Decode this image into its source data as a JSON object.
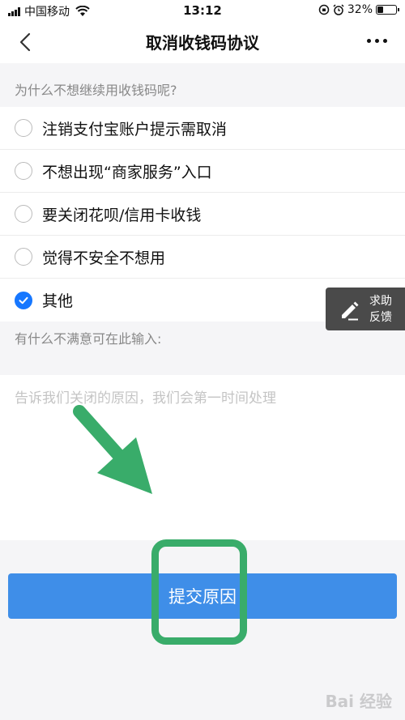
{
  "status_bar": {
    "carrier": "中国移动",
    "time": "13:12",
    "battery": "32%",
    "battery_level": 0.32
  },
  "nav": {
    "title": "取消收钱码协议"
  },
  "question": "为什么不想继续用收钱码呢?",
  "options": [
    {
      "label": "注销支付宝账户提示需取消",
      "checked": false
    },
    {
      "label": "不想出现“商家服务”入口",
      "checked": false
    },
    {
      "label": "要关闭花呗/信用卡收钱",
      "checked": false
    },
    {
      "label": "觉得不安全不想用",
      "checked": false
    },
    {
      "label": "其他",
      "checked": true
    }
  ],
  "feedback": {
    "line1": "求助",
    "line2": "反馈"
  },
  "input_section": {
    "label": "有什么不满意可在此输入:",
    "placeholder": "告诉我们关闭的原因，我们会第一时间处理",
    "value": ""
  },
  "submit_label": "提交原因",
  "watermark": "Bai 经验",
  "colors": {
    "primary": "#3f8ee8",
    "annotation": "#39ac6a"
  }
}
